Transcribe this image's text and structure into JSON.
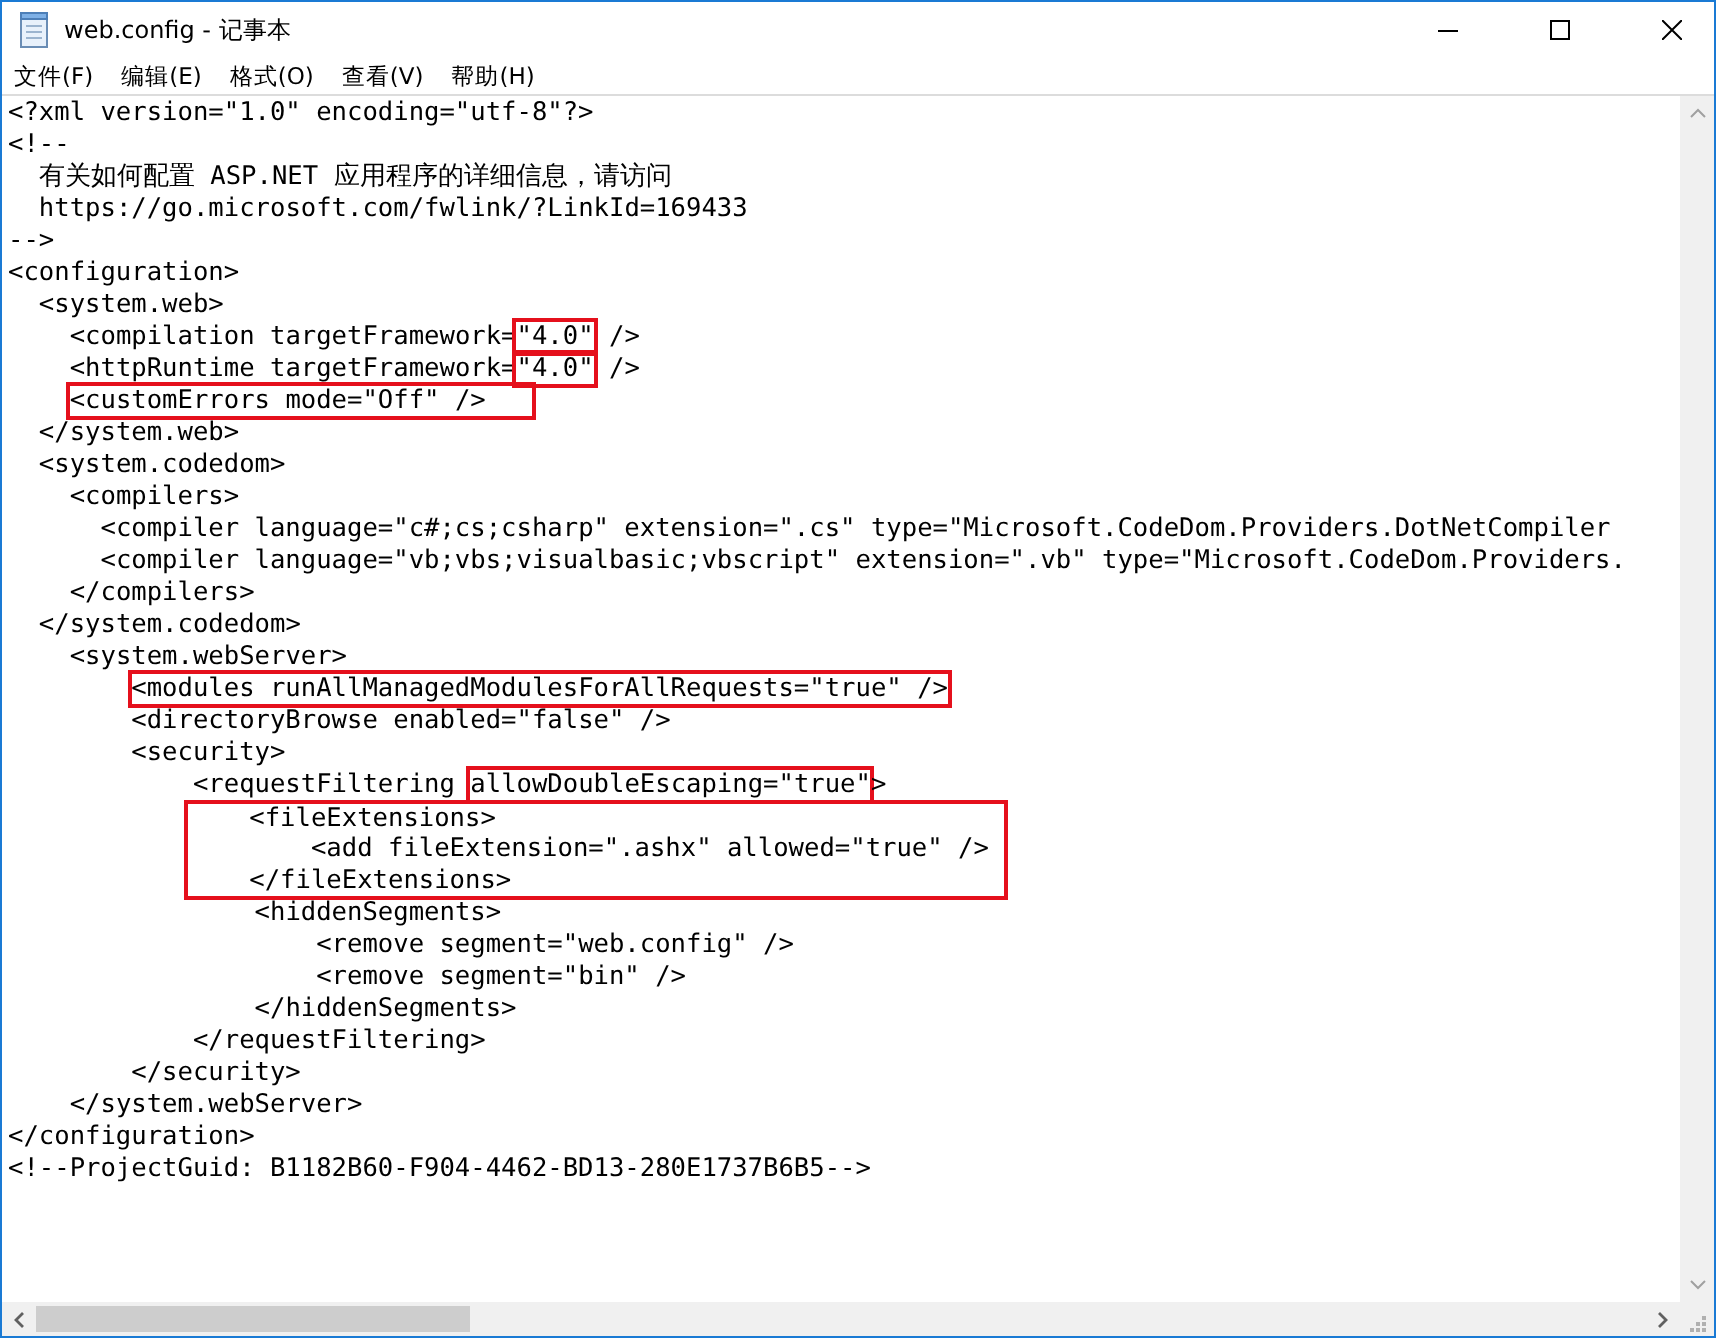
{
  "window": {
    "title": "web.config - 记事本"
  },
  "menu": [
    "文件(F)",
    "编辑(E)",
    "格式(O)",
    "查看(V)",
    "帮助(H)"
  ],
  "editor": {
    "blocks": [
      {
        "kind": "line",
        "segments": [
          {
            "text": "<?xml version=\"1.0\" encoding=\"utf-8\"?>",
            "highlighted": false
          }
        ]
      },
      {
        "kind": "line",
        "segments": [
          {
            "text": "<!--",
            "highlighted": false
          }
        ]
      },
      {
        "kind": "line",
        "segments": [
          {
            "text": "  有关如何配置 ASP.NET 应用程序的详细信息，请访问",
            "highlighted": false
          }
        ]
      },
      {
        "kind": "line",
        "segments": [
          {
            "text": "  https://go.microsoft.com/fwlink/?LinkId=169433",
            "highlighted": false
          }
        ]
      },
      {
        "kind": "line",
        "segments": [
          {
            "text": "-->",
            "highlighted": false
          }
        ]
      },
      {
        "kind": "line",
        "segments": [
          {
            "text": "<configuration>",
            "highlighted": false
          }
        ]
      },
      {
        "kind": "line",
        "segments": [
          {
            "text": "  <system.web>",
            "highlighted": false
          }
        ]
      },
      {
        "kind": "line",
        "segments": [
          {
            "text": "    <compilation targetFramework=",
            "highlighted": false
          },
          {
            "text": "\"4.0\"",
            "highlighted": true
          },
          {
            "text": " />",
            "highlighted": false
          }
        ]
      },
      {
        "kind": "line",
        "segments": [
          {
            "text": "    <httpRuntime targetFramework=",
            "highlighted": false
          },
          {
            "text": "\"4.0\"",
            "highlighted": true
          },
          {
            "text": " />",
            "highlighted": false
          }
        ]
      },
      {
        "kind": "line",
        "segments": [
          {
            "text": "    <customErrors mode=\"Off\" />",
            "highlighted": true
          }
        ]
      },
      {
        "kind": "line",
        "segments": [
          {
            "text": "  </system.web>",
            "highlighted": false
          }
        ]
      },
      {
        "kind": "line",
        "segments": [
          {
            "text": "  <system.codedom>",
            "highlighted": false
          }
        ]
      },
      {
        "kind": "line",
        "segments": [
          {
            "text": "    <compilers>",
            "highlighted": false
          }
        ]
      },
      {
        "kind": "line",
        "segments": [
          {
            "text": "      <compiler language=\"c#;cs;csharp\" extension=\".cs\" type=\"Microsoft.CodeDom.Providers.DotNetCompiler",
            "highlighted": false
          }
        ]
      },
      {
        "kind": "line",
        "segments": [
          {
            "text": "      <compiler language=\"vb;vbs;visualbasic;vbscript\" extension=\".vb\" type=\"Microsoft.CodeDom.Providers.",
            "highlighted": false
          }
        ]
      },
      {
        "kind": "line",
        "segments": [
          {
            "text": "    </compilers>",
            "highlighted": false
          }
        ]
      },
      {
        "kind": "line",
        "segments": [
          {
            "text": "  </system.codedom>",
            "highlighted": false
          }
        ]
      },
      {
        "kind": "line",
        "segments": [
          {
            "text": "    <system.webServer>",
            "highlighted": false
          }
        ]
      },
      {
        "kind": "line",
        "segments": [
          {
            "text": "        <modules runAllManagedModulesForAllRequests=\"true\" />",
            "highlighted": true
          }
        ]
      },
      {
        "kind": "line",
        "segments": [
          {
            "text": "        <directoryBrowse enabled=\"false\" />",
            "highlighted": false
          }
        ]
      },
      {
        "kind": "line",
        "segments": [
          {
            "text": "        <security>",
            "highlighted": false
          }
        ]
      },
      {
        "kind": "line",
        "segments": [
          {
            "text": "            <requestFiltering",
            "highlighted": false
          },
          {
            "text": " allowDoubleEscaping=\"true\"",
            "highlighted": true
          },
          {
            "text": ">",
            "highlighted": false
          }
        ]
      },
      {
        "kind": "boxed_group",
        "lines": [
          "    <fileExtensions>",
          "        <add fileExtension=\".ashx\" allowed=\"true\" />",
          "    </fileExtensions>"
        ]
      },
      {
        "kind": "line",
        "segments": [
          {
            "text": "                <hiddenSegments>",
            "highlighted": false
          }
        ]
      },
      {
        "kind": "line",
        "segments": [
          {
            "text": "                    <remove segment=\"web.config\" />",
            "highlighted": false
          }
        ]
      },
      {
        "kind": "line",
        "segments": [
          {
            "text": "                    <remove segment=\"bin\" />",
            "highlighted": false
          }
        ]
      },
      {
        "kind": "line",
        "segments": [
          {
            "text": "                </hiddenSegments>",
            "highlighted": false
          }
        ]
      },
      {
        "kind": "line",
        "segments": [
          {
            "text": "            </requestFiltering>",
            "highlighted": false
          }
        ]
      },
      {
        "kind": "line",
        "segments": [
          {
            "text": "        </security>",
            "highlighted": false
          }
        ]
      },
      {
        "kind": "line",
        "segments": [
          {
            "text": "    </system.webServer>",
            "highlighted": false
          }
        ]
      },
      {
        "kind": "line",
        "segments": [
          {
            "text": "</configuration>",
            "highlighted": false
          }
        ]
      },
      {
        "kind": "line",
        "segments": [
          {
            "text": "<!--ProjectGuid: B1182B60-F904-4462-BD13-280E1737B6B5-->",
            "highlighted": false
          }
        ]
      }
    ]
  }
}
